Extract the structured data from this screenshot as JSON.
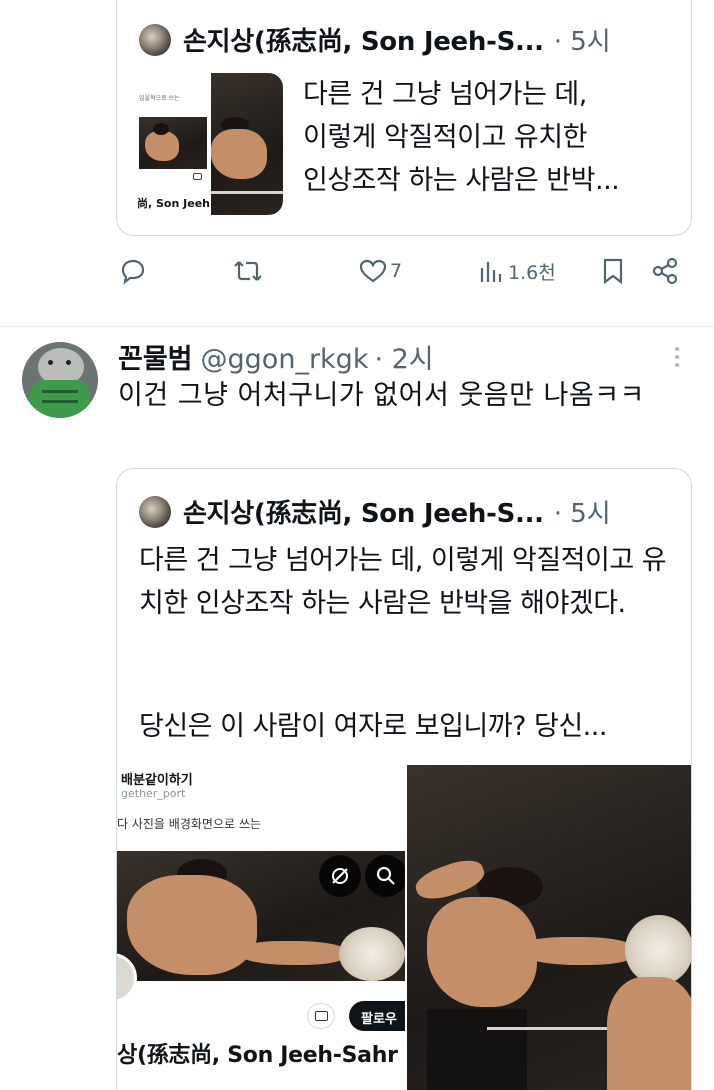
{
  "quote1": {
    "name": "손지상(孫志尚, Son Jeeh-S...",
    "time": "· 5시",
    "text_lines": [
      "다른 건 그냥 넘어가는 데,",
      "이렇게 악질적이고 유치한",
      "인상조작 하는 사람은 반박..."
    ],
    "thumb_caption": "임을혁으로 쓰는",
    "thumb_name": "尚, Son Jeeh-"
  },
  "actions": {
    "reply_icon": "reply-icon",
    "retweet_icon": "retweet-icon",
    "like_icon": "heart-icon",
    "like_count": "7",
    "views_icon": "views-chart-icon",
    "views_count": "1.6천",
    "bookmark_icon": "bookmark-icon",
    "share_icon": "share-icon"
  },
  "post": {
    "display_name": "꼰물범",
    "handle": "@ggon_rkgk",
    "time": "· 2시",
    "text": "이건 그냥 어처구니가 없어서 웃음만 나옴ㅋㅋ",
    "more_icon": "more-vertical-icon"
  },
  "quote2": {
    "name": "손지상(孫志尚, Son Jeeh-S...",
    "time": "· 5시",
    "paragraph1": "다른 건 그냥 넘어가는 데, 이렇게 악질적이고 유치한 인상조작 하는 사람은 반박을 해야겠다.",
    "paragraph2": "당신은 이 사람이 여자로 보입니까? 당신...",
    "media_left": {
      "account_name": "배분같이하기",
      "account_handle": "gether_port",
      "caption": "다 사진을 배경화면으로 쓰는",
      "follow_label": "팔로우",
      "profile_name": "상(孫志尚, Son Jeeh-Sahr"
    }
  },
  "colors": {
    "text": "#0f1419",
    "secondary": "#536471",
    "border": "#cfd9de"
  }
}
